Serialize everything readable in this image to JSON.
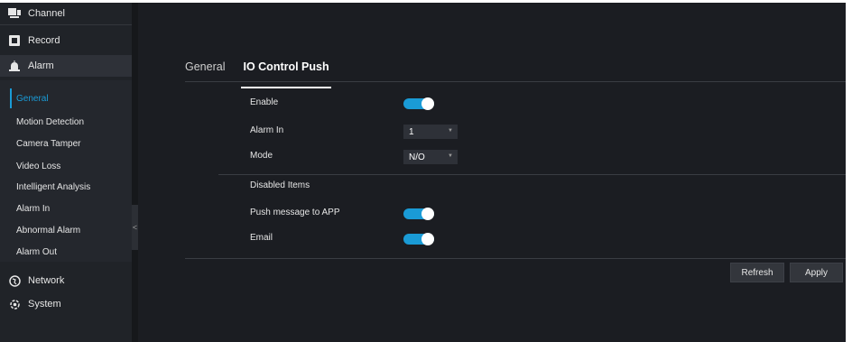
{
  "sidebar": {
    "items": [
      {
        "label": "Channel",
        "icon": "monitor-icon"
      },
      {
        "label": "Record",
        "icon": "record-icon"
      },
      {
        "label": "Alarm",
        "icon": "alarm-icon"
      }
    ],
    "alarm_sub": [
      {
        "label": "General"
      },
      {
        "label": "Motion Detection"
      },
      {
        "label": "Camera Tamper"
      },
      {
        "label": "Video Loss"
      },
      {
        "label": "Intelligent Analysis"
      },
      {
        "label": "Alarm In"
      },
      {
        "label": "Abnormal Alarm"
      },
      {
        "label": "Alarm Out"
      }
    ],
    "bottom_items": [
      {
        "label": "Network",
        "icon": "globe-icon"
      },
      {
        "label": "System",
        "icon": "gear-icon"
      }
    ],
    "collapse_glyph": "<"
  },
  "tabs": [
    "General",
    "IO Control Push"
  ],
  "form": {
    "enable_label": "Enable",
    "enable_value": true,
    "alarm_in_label": "Alarm In",
    "alarm_in_value": "1",
    "mode_label": "Mode",
    "mode_value": "N/O",
    "disabled_items_label": "Disabled Items",
    "push_label": "Push message to APP",
    "push_value": true,
    "email_label": "Email",
    "email_value": true
  },
  "buttons": {
    "refresh": "Refresh",
    "apply": "Apply"
  },
  "colors": {
    "accent": "#1a9bd6",
    "background": "#1b1d22",
    "sidebar": "#202328"
  }
}
